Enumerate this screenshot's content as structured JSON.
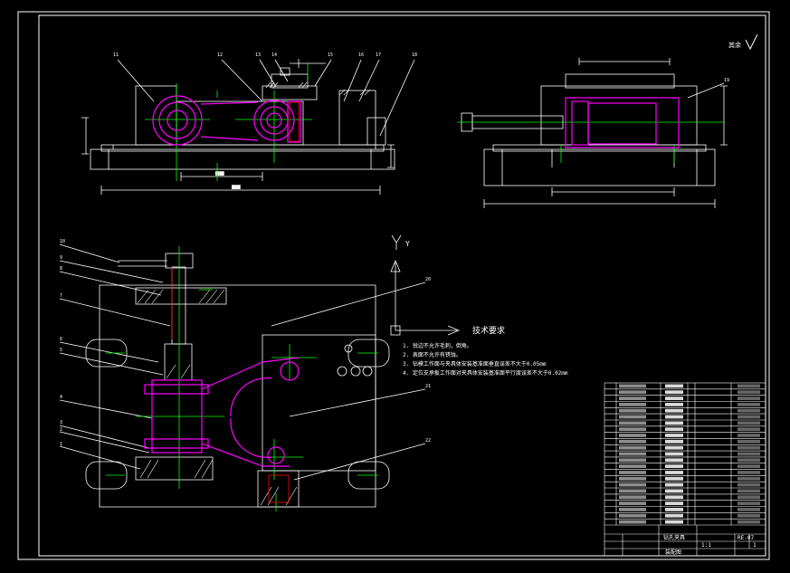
{
  "drawing": {
    "roughness_mark": "其余",
    "view_marker": "Y",
    "tech_title": "技术要求",
    "tech_notes": [
      "1. 锐边不允许毛刺，倒角。",
      "2. 表面不允许有锈蚀。",
      "3. 钻模工作面与夹具体安装基准面垂直误差不大于0.05mm",
      "4. 定位支承板工作面对夹具体安装基准面平行度误差不大于0.02mm"
    ],
    "balloons_top": [
      "11",
      "12",
      "13",
      "14",
      "15",
      "16",
      "17",
      "18"
    ],
    "balloons_top_right": [
      "19"
    ],
    "balloons_main_left": [
      "10",
      "9",
      "8",
      "7",
      "6",
      "5",
      "4",
      "3",
      "2",
      "1"
    ],
    "balloons_main_right": [
      "20",
      "21",
      "22"
    ]
  },
  "title_block": {
    "title": "钻孔夹具",
    "subtitle": "装配图",
    "drawing_no": "RE-07",
    "scale": "1:1",
    "sheet": "1",
    "parts_rows": 23,
    "colors": {
      "lines": "#ffffff",
      "green": "#00ff00",
      "magenta": "#ff00ff",
      "red": "#ff0000",
      "cyan": "#00ffff"
    }
  }
}
